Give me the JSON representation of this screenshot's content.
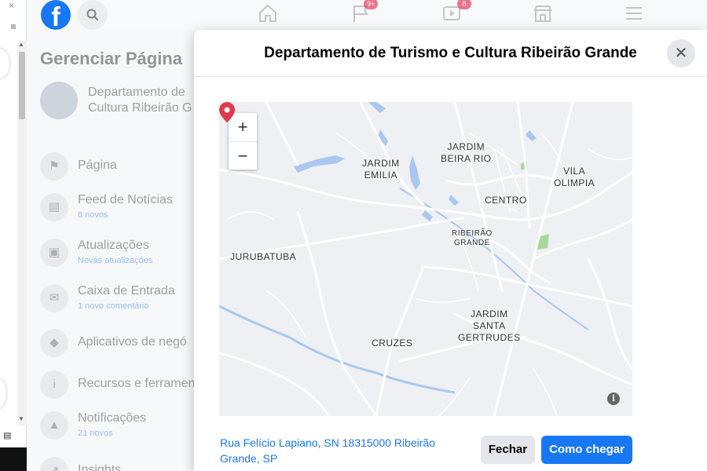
{
  "colors": {
    "accent": "#1877f2",
    "badge": "#e41e3f",
    "pin": "#e0394d",
    "water": "#a8c8f0",
    "road": "#ffffff",
    "park": "#a8d89a",
    "map_bg": "#eef0f3"
  },
  "topbar": {
    "logo_letter": "f",
    "icons": [
      "home-icon",
      "flag-icon",
      "video-icon",
      "marketplace-icon",
      "menu-icon"
    ],
    "flag_badge": "9+",
    "video_badge": "8"
  },
  "left_panel": {
    "title": "Gerenciar Página",
    "page_name_line1": "Departamento de",
    "page_name_line2": "Cultura Ribeirão G",
    "items": [
      {
        "label": "Página",
        "sub": "",
        "icon": "flag-icon"
      },
      {
        "label": "Feed de Notícias",
        "sub": "8 novos",
        "icon": "feed-icon"
      },
      {
        "label": "Atualizações",
        "sub": "Novas atualizações",
        "icon": "updates-icon"
      },
      {
        "label": "Caixa de Entrada",
        "sub": "1 novo comentário",
        "icon": "inbox-icon"
      },
      {
        "label": "Aplicativos de negó",
        "sub": "",
        "icon": "apps-icon"
      },
      {
        "label": "Recursos e ferramen",
        "sub": "",
        "icon": "info-icon"
      },
      {
        "label": "Notificações",
        "sub": "21 novos",
        "icon": "bell-icon"
      },
      {
        "label": "Insights",
        "sub": "",
        "icon": "insights-icon"
      }
    ]
  },
  "modal": {
    "title": "Departamento de Turismo e Cultura Ribeirão Grande",
    "close_symbol": "✕",
    "map": {
      "zoom_in": "+",
      "zoom_out": "−",
      "labels": {
        "jardim_emilia_1": "JARDIM",
        "jardim_emilia_2": "EMILIA",
        "jardim_beira_1": "JARDIM",
        "jardim_beira_2": "BEIRA RIO",
        "vila_olimpia_1": "VILA",
        "vila_olimpia_2": "OLIMPIA",
        "centro": "CENTRO",
        "ribeirao_1": "RIBEIRÃO",
        "ribeirao_2": "GRANDE",
        "jurubatuba": "JURUBATUBA",
        "cruzes": "CRUZES",
        "santa_1": "JARDIM",
        "santa_2": "SANTA",
        "santa_3": "GERTRUDES"
      },
      "info_symbol": "i"
    },
    "address": "Rua Felício Lapiano, SN 18315000 Ribeirão Grande, SP",
    "close_label": "Fechar",
    "directions_label": "Como chegar"
  }
}
